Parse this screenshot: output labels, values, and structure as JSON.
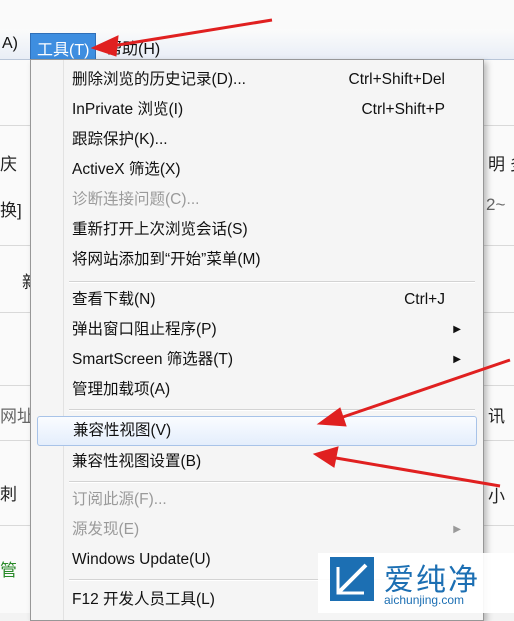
{
  "menubar": {
    "left_partial": "A)",
    "tools": "工具(T)",
    "help": "帮助(H)"
  },
  "background": {
    "left_texts": [
      "庆",
      "换]",
      "新",
      "网址",
      "刺",
      "管"
    ],
    "right_texts": [
      "明 多",
      "2~",
      "讯",
      "小"
    ]
  },
  "menu": {
    "items": [
      {
        "label": "删除浏览的历史记录(D)...",
        "shortcut": "Ctrl+Shift+Del"
      },
      {
        "label": "InPrivate 浏览(I)",
        "shortcut": "Ctrl+Shift+P"
      },
      {
        "label": "跟踪保护(K)..."
      },
      {
        "label": "ActiveX 筛选(X)"
      },
      {
        "label": "诊断连接问题(C)...",
        "disabled": true
      },
      {
        "label": "重新打开上次浏览会话(S)"
      },
      {
        "label": "将网站添加到“开始”菜单(M)"
      },
      {
        "label": "查看下载(N)",
        "shortcut": "Ctrl+J"
      },
      {
        "label": "弹出窗口阻止程序(P)",
        "submenu": "▶"
      },
      {
        "label": "SmartScreen 筛选器(T)",
        "submenu": "▶"
      },
      {
        "label": "管理加载项(A)"
      },
      {
        "label": "兼容性视图(V)"
      },
      {
        "label": "兼容性视图设置(B)"
      },
      {
        "label": "订阅此源(F)...",
        "disabled": true
      },
      {
        "label": "源发现(E)",
        "disabled": true,
        "submenu": "▶"
      },
      {
        "label": "Windows Update(U)"
      },
      {
        "label": "F12 开发人员工具(L)"
      }
    ]
  },
  "watermark": {
    "title": "爱纯净",
    "url": "aichunjing.com"
  },
  "colors": {
    "arrow": "#e02020",
    "accent": "#3e8ee0",
    "watermark": "#1c6fb3"
  }
}
